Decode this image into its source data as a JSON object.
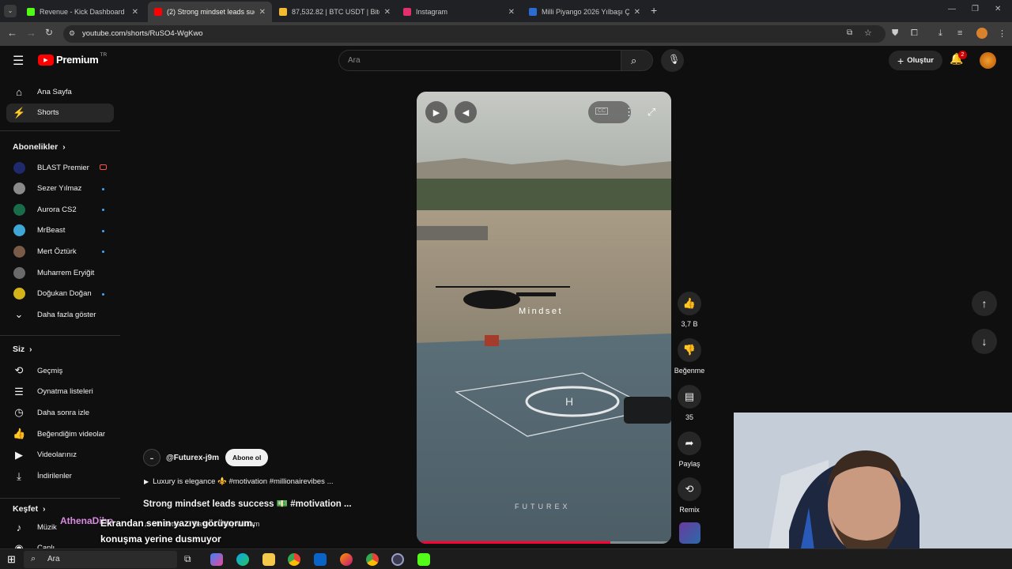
{
  "browser": {
    "tabs": [
      {
        "title": "Revenue - Kick Dashboard",
        "favicon_color": "#53fc18",
        "active": false
      },
      {
        "title": "(2) Strong mindset leads succes",
        "favicon_color": "#ff0000",
        "active": true
      },
      {
        "title": "87,532.82 | BTC USDT | Bitcoin t",
        "favicon_color": "#f3ba2f",
        "active": false
      },
      {
        "title": "Instagram",
        "favicon_color": "#e1306c",
        "active": false
      },
      {
        "title": "Milli Piyango 2026 Yılbaşı Çekil",
        "favicon_color": "#2b6cd4",
        "active": false
      }
    ],
    "new_tab_glyph": "+",
    "url": "youtube.com/shorts/RuSO4-WgKwo"
  },
  "header": {
    "logo_text": "Premium",
    "logo_region": "TR",
    "search_placeholder": "Ara",
    "create_label": "Oluştur",
    "notification_count": "2"
  },
  "sidebar": {
    "main": [
      {
        "label": "Ana Sayfa",
        "icon": "home-icon",
        "active": false
      },
      {
        "label": "Shorts",
        "icon": "shorts-icon",
        "active": true
      }
    ],
    "subscriptions_heading": "Abonelikler",
    "subscriptions": [
      {
        "label": "BLAST Premier",
        "avatar_color": "#1e2a6b",
        "badge": "live"
      },
      {
        "label": "Sezer Yılmaz",
        "avatar_color": "#8a8a8a",
        "badge": "dot"
      },
      {
        "label": "Aurora CS2",
        "avatar_color": "#1a6b4a",
        "badge": "dot"
      },
      {
        "label": "MrBeast",
        "avatar_color": "#3fa7d6",
        "badge": "dot"
      },
      {
        "label": "Mert Öztürk",
        "avatar_color": "#7a5a48",
        "badge": "dot"
      },
      {
        "label": "Muharrem Eryiğit",
        "avatar_color": "#6a6a6a",
        "badge": "none"
      },
      {
        "label": "Doğukan Doğan",
        "avatar_color": "#d4b21a",
        "badge": "dot"
      }
    ],
    "show_more_label": "Daha fazla göster",
    "you_heading": "Siz",
    "you_items": [
      {
        "label": "Geçmiş",
        "icon": "history-icon"
      },
      {
        "label": "Oynatma listeleri",
        "icon": "playlists-icon"
      },
      {
        "label": "Daha sonra izle",
        "icon": "watch-later-icon"
      },
      {
        "label": "Beğendiğim videolar",
        "icon": "liked-videos-icon"
      },
      {
        "label": "Videolarınız",
        "icon": "your-videos-icon"
      },
      {
        "label": "İndirilenler",
        "icon": "downloads-icon"
      }
    ],
    "explore_heading": "Keşfet",
    "explore_items": [
      {
        "label": "Müzik",
        "icon": "music-icon"
      },
      {
        "label": "Canlı",
        "icon": "live-icon"
      }
    ]
  },
  "video": {
    "overlay_text": "Mindset",
    "watermark": "FUTUREX",
    "progress": 0.76,
    "channel_handle": "@Futurex-j9m",
    "subscribe_label": "Abone ol",
    "description": "Luxury is elegance ⚜️ #motivation #millionairevibes ...",
    "title": "Strong mindset leads success 💵 #motivation ...",
    "music": "Mr Bettie · 3 Bavin & Willy William"
  },
  "actions": {
    "like_count": "3,7 B",
    "dislike_label": "Beğenme",
    "comments_count": "35",
    "share_label": "Paylaş",
    "remix_label": "Remix"
  },
  "chat": {
    "username": "AthenaDiho",
    "message": "Ekrandan senin yazıyı görüyorum, konuşma yerine dusmuyor"
  },
  "taskbar": {
    "search_placeholder": "Ara"
  }
}
